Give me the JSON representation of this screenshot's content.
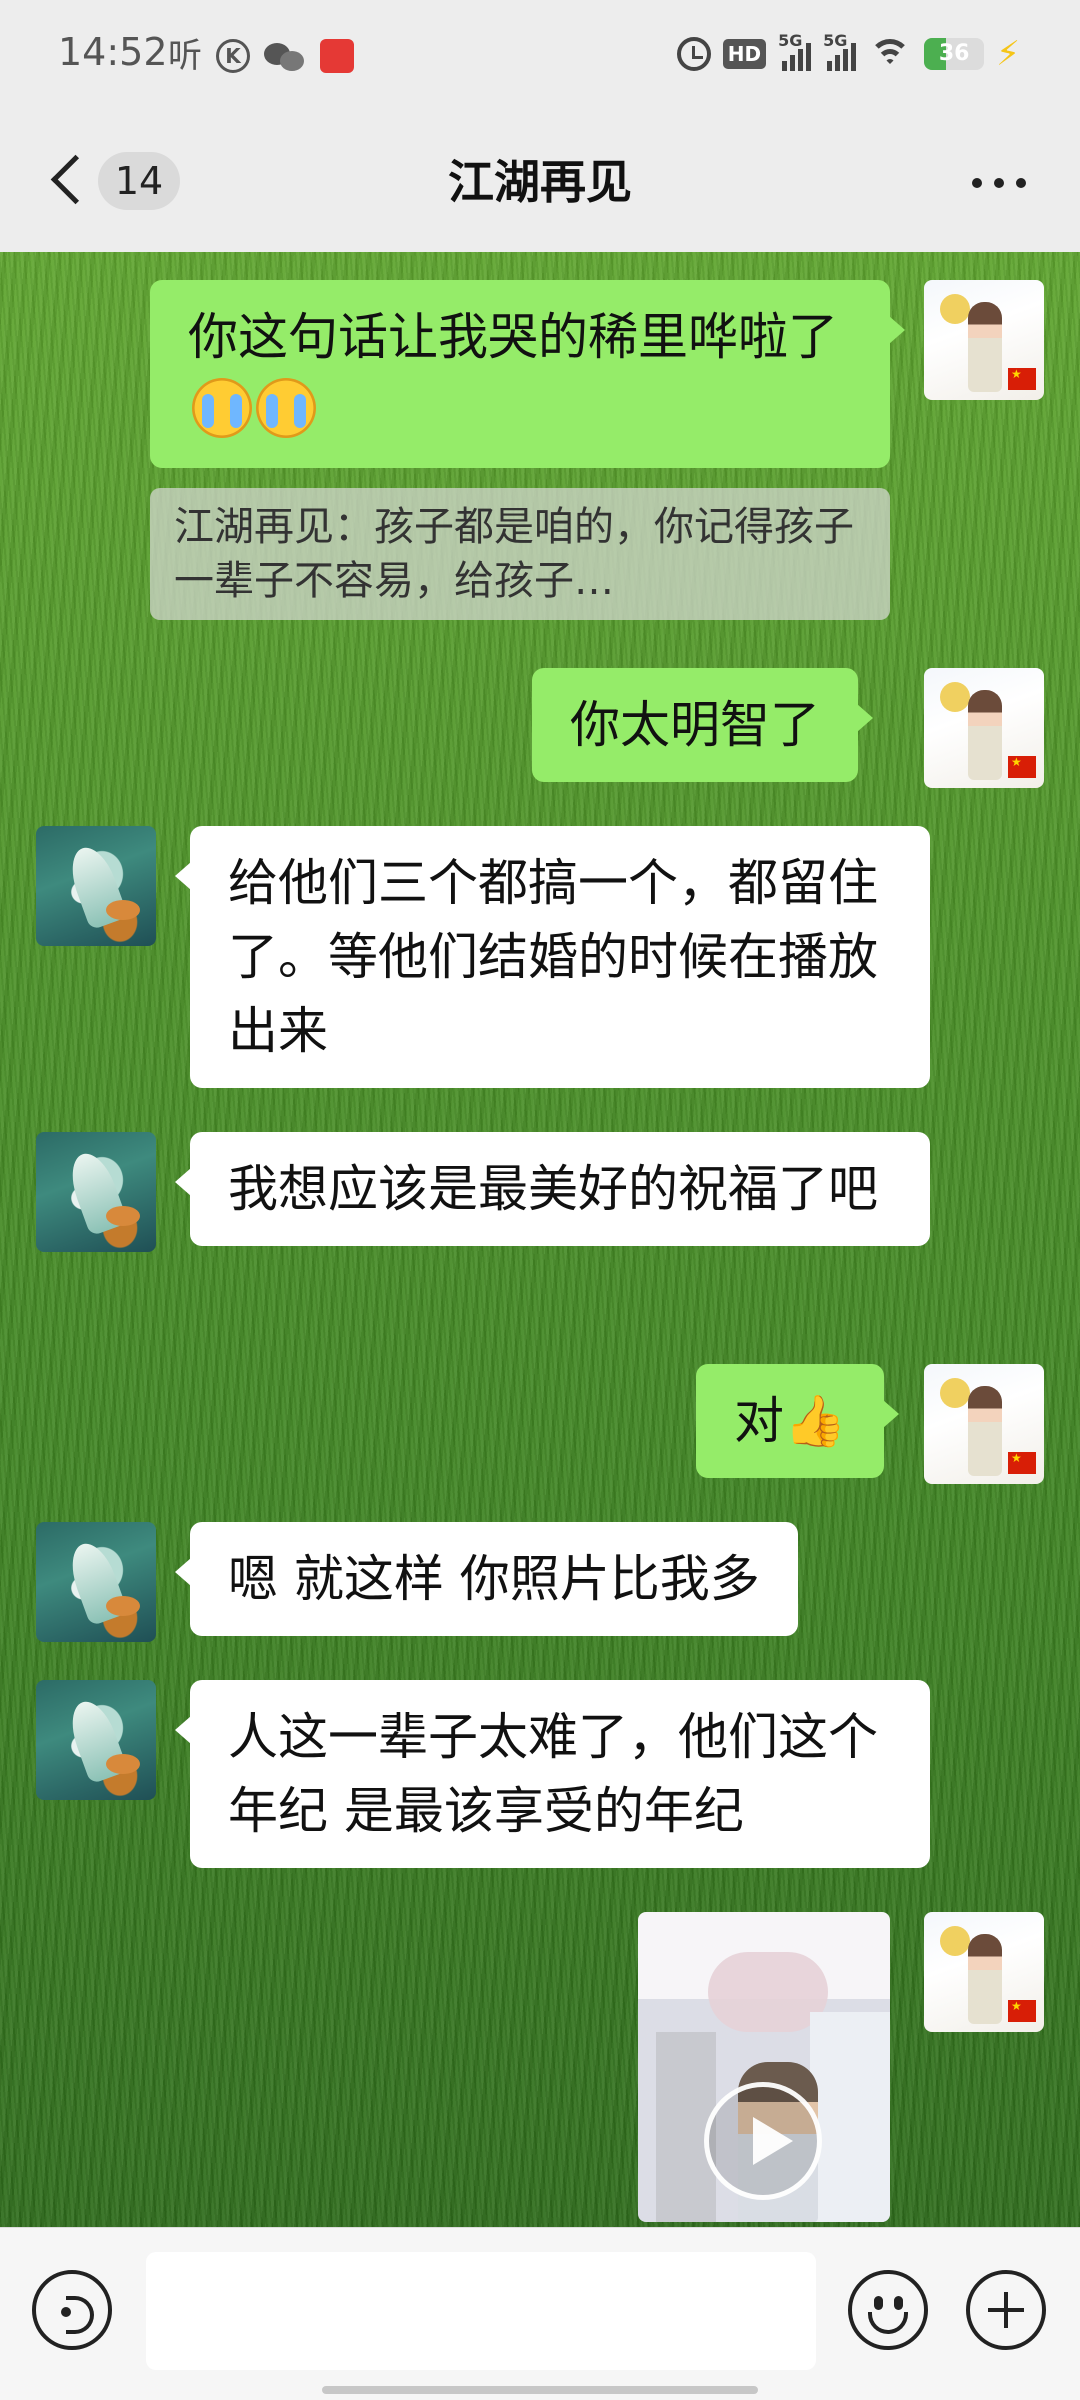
{
  "status_bar": {
    "time": "14:52",
    "listen_label": "听",
    "k_label": "K",
    "hd_label": "HD",
    "signal1_label": "5G",
    "signal2_label": "5G",
    "battery": "36",
    "battery_level_pct": 36,
    "icons": [
      "k-circle-icon",
      "wechat-icon",
      "red-app-icon",
      "alarm-icon",
      "hd-icon",
      "signal-5g-icon",
      "wifi-icon",
      "battery-icon",
      "charging-icon"
    ]
  },
  "header": {
    "unread_count": "14",
    "title": "江湖再见",
    "more_icon": "more-dots-icon"
  },
  "messages": [
    {
      "side": "me",
      "text": "你这句话让我哭的稀里哗啦了",
      "emojis": [
        "loudly-crying-face",
        "loudly-crying-face"
      ]
    },
    {
      "type": "quote",
      "text": "江湖再见：孩子都是咱的，你记得孩子一辈子不容易，给孩子…"
    },
    {
      "side": "me",
      "text": "你太明智了"
    },
    {
      "side": "them",
      "text": "给他们三个都搞一个，都留住了。等他们结婚的时候在播放出来"
    },
    {
      "side": "them",
      "text": "我想应该是最美好的祝福了吧"
    },
    {
      "side": "me",
      "text": "对",
      "emoji": "thumbs-up"
    },
    {
      "side": "them",
      "text": "嗯 就这样 你照片比我多"
    },
    {
      "side": "them",
      "text": "人这一辈子太难了，他们这个年纪 是最该享受的年纪"
    },
    {
      "side": "me",
      "type": "video",
      "icon": "play-icon"
    }
  ],
  "input_bar": {
    "voice_icon": "voice-icon",
    "emoji_icon": "emoji-icon",
    "plus_icon": "plus-icon",
    "text_value": ""
  },
  "colors": {
    "my_bubble": "#95ec69",
    "their_bubble": "#ffffff",
    "bar_background": "#ededed"
  }
}
